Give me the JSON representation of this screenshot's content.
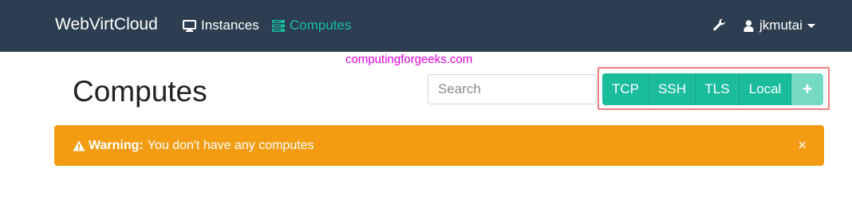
{
  "navbar": {
    "brand": "WebVirtCloud",
    "links": [
      {
        "label": "Instances",
        "icon": "monitor-icon"
      },
      {
        "label": "Computes",
        "icon": "server-icon",
        "active": true
      }
    ],
    "tools_icon": "wrench-icon",
    "user": {
      "name": "jkmutai",
      "icon": "user-icon"
    }
  },
  "watermark": "computingforgeeks.com",
  "page": {
    "title": "Computes"
  },
  "search": {
    "placeholder": "Search",
    "value": ""
  },
  "connection_buttons": [
    {
      "label": "TCP"
    },
    {
      "label": "SSH"
    },
    {
      "label": "TLS"
    },
    {
      "label": "Local"
    },
    {
      "label": "+"
    }
  ],
  "alert": {
    "title": "Warning:",
    "message": "You don't have any computes",
    "close": "×",
    "icon": "warning-triangle-icon"
  },
  "colors": {
    "navbar_bg": "#2c3e50",
    "accent": "#18bc9c",
    "button": "#1abc9c",
    "button_add": "#75d9c3",
    "alert_bg": "#f39c12",
    "watermark": "#e000e0",
    "highlight": "#f08080"
  }
}
